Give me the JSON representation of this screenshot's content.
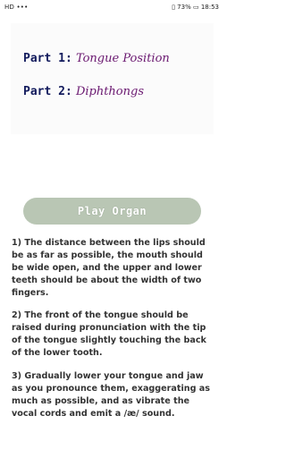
{
  "status_bar": {
    "left": "HD •••",
    "battery": "73%",
    "time": "18:53"
  },
  "lessons": [
    {
      "number": "Part 1:",
      "topic": "Tongue Position"
    },
    {
      "number": "Part 2:",
      "topic": "Diphthongs"
    }
  ],
  "play_button": "Play Organ",
  "instructions": [
    "1) The distance between the lips should be as far as possible, the mouth should be wide open, and the upper and lower teeth should be about the width of two fingers.",
    "2) The front of the tongue should be raised during pronunciation with the tip of the tongue slightly touching the back of the lower tooth.",
    "3) Gradually lower your tongue and jaw as you pronounce them, exaggerating as much as possible, and as vibrate the vocal cords and emit a /æ/ sound."
  ]
}
